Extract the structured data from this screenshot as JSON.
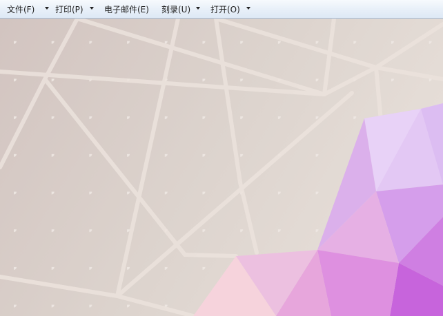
{
  "toolbar": {
    "menus": [
      {
        "label": "文件(F)",
        "has_dropdown": true
      },
      {
        "label": "打印(P)",
        "has_dropdown": true
      },
      {
        "label": "电子邮件(E)",
        "has_dropdown": false
      },
      {
        "label": "刻录(U)",
        "has_dropdown": true
      },
      {
        "label": "打开(O)",
        "has_dropdown": true
      }
    ]
  },
  "wallpaper": {
    "description_colors": {
      "background": "#d9cfca",
      "lines": "#ebe2dc",
      "dots": "#efe9e5",
      "poly_purple": "#c963dd",
      "poly_lilac": "#e3c6f5",
      "poly_pink": "#f4c9e0"
    }
  }
}
